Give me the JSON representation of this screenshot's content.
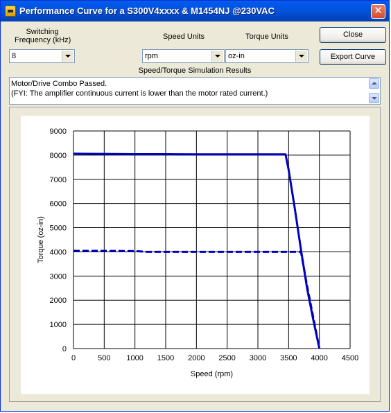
{
  "window": {
    "title": "Performance Curve for a S300V4xxxx & M1454NJ @230VAC",
    "close_glyph": "✕"
  },
  "controls": {
    "switching_label_line1": "Switching",
    "switching_label_line2": "Frequency (kHz)",
    "switching_value": "8",
    "speed_units_label": "Speed Units",
    "speed_units_value": "rpm",
    "torque_units_label": "Torque Units",
    "torque_units_value": "oz-in",
    "close_button": "Close",
    "export_button": "Export Curve"
  },
  "results": {
    "heading": "Speed/Torque Simulation Results",
    "line1": "Motor/Drive Combo Passed.",
    "line2": "(FYI: The amplifier continuous current is lower than the motor rated current.)"
  },
  "chart_data": {
    "type": "line",
    "title": "",
    "xlabel": "Speed (rpm)",
    "ylabel": "Torque (oz-in)",
    "xlim": [
      0,
      4500
    ],
    "ylim": [
      0,
      9000
    ],
    "x_ticks": [
      0,
      500,
      1000,
      1500,
      2000,
      2500,
      3000,
      3500,
      4000,
      4500
    ],
    "y_ticks": [
      0,
      1000,
      2000,
      3000,
      4000,
      5000,
      6000,
      7000,
      8000,
      9000
    ],
    "grid": true,
    "legend": "none",
    "series": [
      {
        "style": "solid",
        "color": "#0000c0",
        "points": [
          [
            0,
            8060
          ],
          [
            500,
            8050
          ],
          [
            1000,
            8040
          ],
          [
            1500,
            8040
          ],
          [
            2000,
            8030
          ],
          [
            2500,
            8030
          ],
          [
            3000,
            8030
          ],
          [
            3450,
            8030
          ],
          [
            3500,
            7400
          ],
          [
            3600,
            5800
          ],
          [
            3700,
            4100
          ],
          [
            3800,
            2500
          ],
          [
            3900,
            1200
          ],
          [
            4000,
            0
          ]
        ]
      },
      {
        "style": "dashed",
        "color": "#0000c0",
        "points": [
          [
            0,
            4040
          ],
          [
            500,
            4040
          ],
          [
            1000,
            4030
          ],
          [
            1200,
            4000
          ],
          [
            1500,
            4000
          ],
          [
            2000,
            4000
          ],
          [
            2500,
            4000
          ],
          [
            3000,
            4000
          ],
          [
            3500,
            4000
          ],
          [
            3700,
            4000
          ],
          [
            3800,
            2600
          ],
          [
            3900,
            1300
          ],
          [
            4000,
            0
          ]
        ]
      }
    ]
  }
}
